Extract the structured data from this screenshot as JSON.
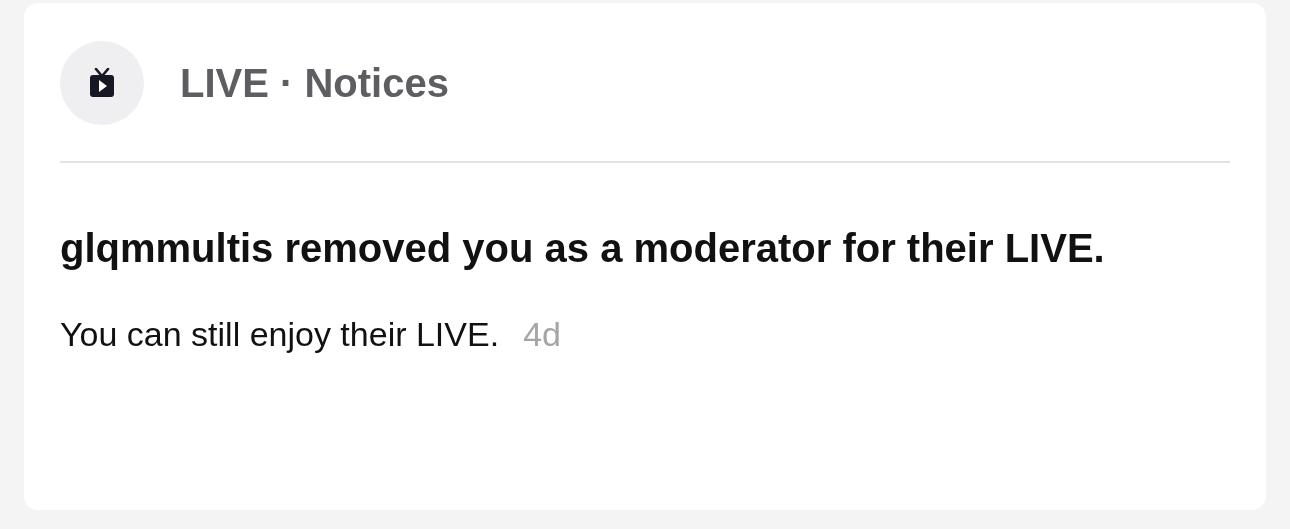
{
  "notice": {
    "source": "LIVE · Notices",
    "title": "glqmmultis removed you as a moderator for their LIVE.",
    "message": "You can still enjoy their LIVE.",
    "time": "4d"
  }
}
